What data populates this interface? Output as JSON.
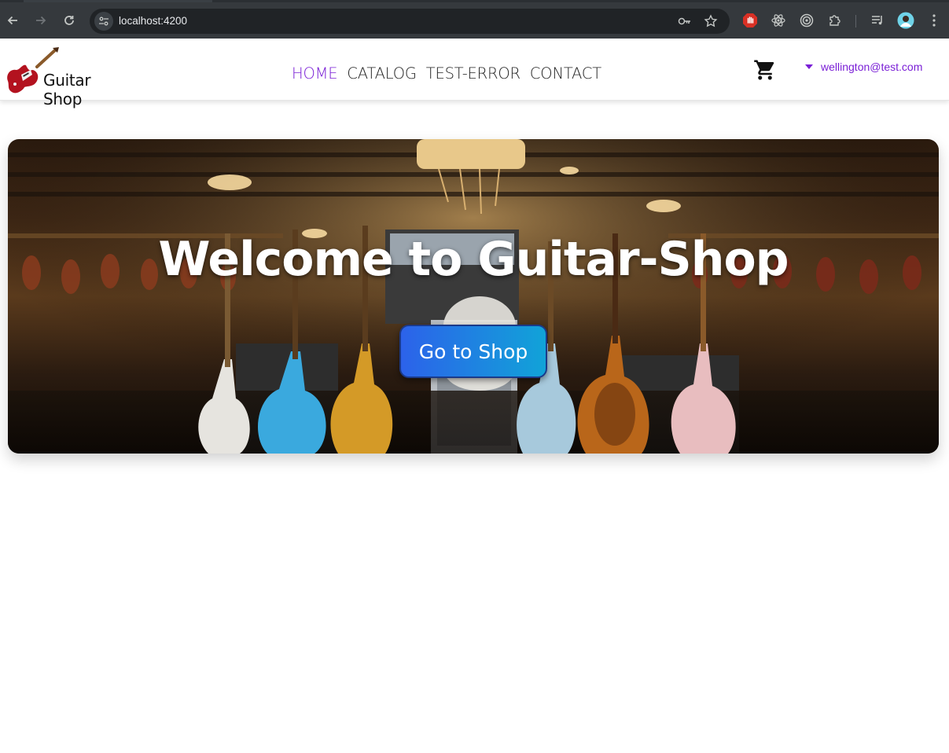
{
  "browser": {
    "url": "localhost:4200",
    "icons": {
      "back": "arrow-left-icon",
      "forward": "arrow-right-icon",
      "reload": "reload-icon",
      "site_info": "tune-icon",
      "password": "key-icon",
      "bookmark": "star-icon",
      "extension_1": "stop-hand-icon",
      "extension_2": "react-icon",
      "extension_3": "target-icon",
      "extensions": "puzzle-icon",
      "media": "playlist-icon",
      "profile": "avatar",
      "menu": "kebab-menu-icon"
    }
  },
  "header": {
    "logo_text": "Guitar Shop",
    "nav": [
      {
        "label": "HOME",
        "active": true
      },
      {
        "label": "CATALOG",
        "active": false
      },
      {
        "label": "TEST-ERROR",
        "active": false
      },
      {
        "label": "CONTACT",
        "active": false
      }
    ],
    "cart_icon": "cart-icon",
    "user_email": "wellington@test.com",
    "user_menu_icon": "caret-down-icon"
  },
  "hero": {
    "title": "Welcome to Guitar-Shop",
    "button_label": "Go to Shop"
  },
  "colors": {
    "accent": "#7a1fd6",
    "button_start": "#2c62ea",
    "button_end": "#11a3d8"
  }
}
